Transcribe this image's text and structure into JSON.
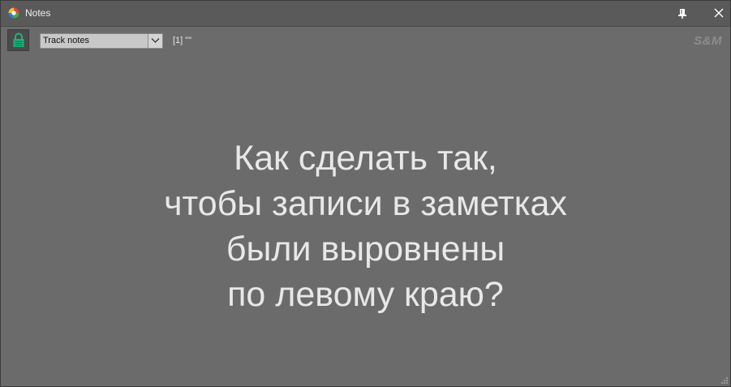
{
  "window": {
    "title": "Notes"
  },
  "toolbar": {
    "lock_icon": "lock-icon",
    "notes_type": "Track notes",
    "track_info": "[1] \"\"",
    "brand": "S&M"
  },
  "notes": {
    "lines": [
      "Как сделать так,",
      "чтобы записи в заметках",
      "были выровнены",
      "по левому краю?"
    ]
  },
  "colors": {
    "background": "#6b6b6b",
    "titlebar": "#5a5a5a",
    "lock_green": "#1db37a",
    "text": "#e8e8e8"
  }
}
